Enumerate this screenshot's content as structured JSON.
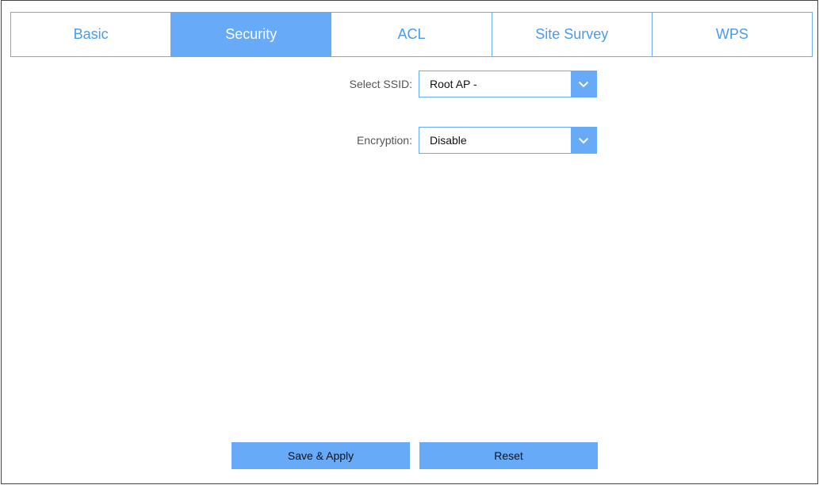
{
  "tabs": [
    {
      "label": "Basic",
      "active": false
    },
    {
      "label": "Security",
      "active": true
    },
    {
      "label": "ACL",
      "active": false
    },
    {
      "label": "Site Survey",
      "active": false
    },
    {
      "label": "WPS",
      "active": false
    }
  ],
  "form": {
    "ssid": {
      "label": "Select SSID:",
      "value": "Root AP -",
      "arrow_icon": "chevron-down-icon"
    },
    "encryption": {
      "label": "Encryption:",
      "value": "Disable",
      "arrow_icon": "chevron-down-icon"
    }
  },
  "buttons": {
    "save_label": "Save & Apply",
    "reset_label": "Reset"
  },
  "colors": {
    "accent": "#66aaf8",
    "tab_text": "#4a9af0",
    "label_text": "#555555"
  }
}
